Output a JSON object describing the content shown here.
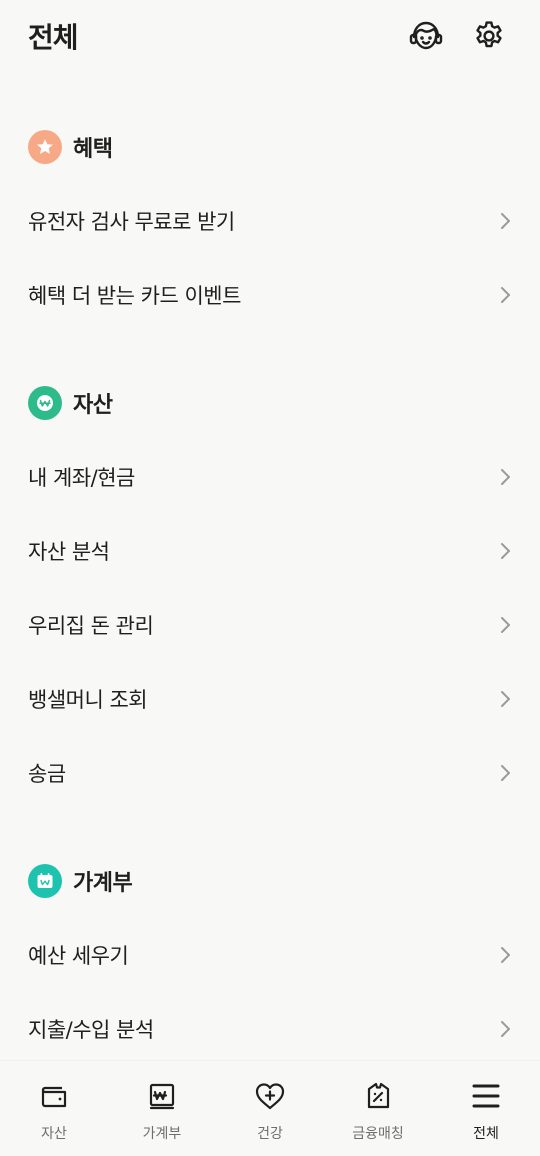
{
  "header": {
    "title": "전체"
  },
  "sections": [
    {
      "title": "혜택",
      "badge_color": "#f7a987",
      "items": [
        "유전자 검사 무료로 받기",
        "혜택 더 받는 카드 이벤트"
      ]
    },
    {
      "title": "자산",
      "badge_color": "#2dbb8b",
      "items": [
        "내 계좌/현금",
        "자산 분석",
        "우리집 돈 관리",
        "뱅샐머니 조회",
        "송금"
      ]
    },
    {
      "title": "가계부",
      "badge_color": "#1ec3b0",
      "items": [
        "예산 세우기",
        "지출/수입 분석"
      ]
    }
  ],
  "bottom_nav": [
    {
      "label": "자산",
      "icon": "wallet-icon",
      "active": false
    },
    {
      "label": "가계부",
      "icon": "ledger-icon",
      "active": false
    },
    {
      "label": "건강",
      "icon": "heart-plus-icon",
      "active": false
    },
    {
      "label": "금융매칭",
      "icon": "coupon-percent-icon",
      "active": false
    },
    {
      "label": "전체",
      "icon": "menu-icon",
      "active": true
    }
  ]
}
